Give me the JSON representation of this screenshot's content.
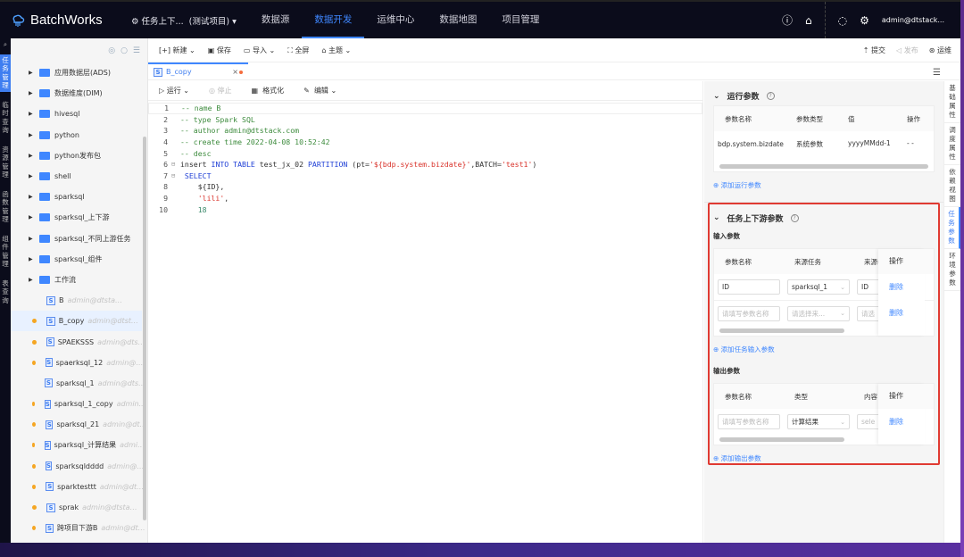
{
  "app": {
    "title": "BatchWorks",
    "project": "任务上下...",
    "project_env": "(测试项目)",
    "nav": [
      "数据源",
      "数据开发",
      "运维中心",
      "数据地图",
      "项目管理"
    ],
    "active_nav": "数据开发",
    "user": "admin@dtstack..."
  },
  "rail": [
    "任务管理",
    "临时查询",
    "资源管理",
    "函数管理",
    "组件管理",
    "表查询"
  ],
  "tree": {
    "folders": [
      "应用数据层(ADS)",
      "数据维度(DIM)",
      "hivesql",
      "python",
      "python发布包",
      "shell",
      "sparksql",
      "sparksql_上下游",
      "sparksql_不同上游任务",
      "sparksql_组件",
      "工作流"
    ],
    "files": [
      {
        "name": "B",
        "owner": "admin@dtstack.com 锁...",
        "dot": false
      },
      {
        "name": "B_copy",
        "owner": "admin@dtstack...",
        "dot": true
      },
      {
        "name": "SPAEKSSS",
        "owner": "admin@dtsta...",
        "dot": true
      },
      {
        "name": "spaerksql_12",
        "owner": "admin@dt...",
        "dot": true
      },
      {
        "name": "sparksql_1",
        "owner": "admin@dtsta...",
        "dot": false
      },
      {
        "name": "sparksql_1_copy",
        "owner": "admin...",
        "dot": true
      },
      {
        "name": "sparksql_21",
        "owner": "admin@dtst...",
        "dot": true
      },
      {
        "name": "sparksql_计算结果",
        "owner": "admin...",
        "dot": true
      },
      {
        "name": "sparksqldddd",
        "owner": "admin@dt...",
        "dot": true
      },
      {
        "name": "sparktesttt",
        "owner": "admin@dtsta...",
        "dot": true
      },
      {
        "name": "sprak",
        "owner": "admin@dtstack.co...",
        "dot": true
      },
      {
        "name": "跨项目下游B",
        "owner": "admin@dtst...",
        "dot": true
      }
    ]
  },
  "toolbar": {
    "new": "新建",
    "save": "保存",
    "import": "导入",
    "fullscreen": "全屏",
    "theme": "主题",
    "submit": "提交",
    "publish": "发布",
    "ops": "运维"
  },
  "tab": {
    "label": "B_copy",
    "icon_letter": "S"
  },
  "editor_toolbar": {
    "run": "运行",
    "stop": "停止",
    "format": "格式化",
    "edit": "编辑"
  },
  "code": [
    [
      [
        "cm",
        "-- name B"
      ]
    ],
    [
      [
        "cm",
        "-- type Spark SQL"
      ]
    ],
    [
      [
        "cm",
        "-- author admin@dtstack.com"
      ]
    ],
    [
      [
        "cm",
        "-- create time 2022-04-08 10:52:42"
      ]
    ],
    [
      [
        "cm",
        "-- desc"
      ]
    ],
    [
      [
        "",
        "insert "
      ],
      [
        "kw",
        "INTO TABLE"
      ],
      [
        "",
        " test_jx_02 "
      ],
      [
        "kw",
        "PARTITION"
      ],
      [
        "",
        " (pt="
      ],
      [
        "st",
        "'${bdp.system.bizdate}'"
      ],
      [
        "",
        ",BATCH="
      ],
      [
        "st",
        "'test1'"
      ],
      [
        "",
        ")"
      ]
    ],
    [
      [
        "kw",
        " SELECT"
      ]
    ],
    [
      [
        "",
        "    ${ID},"
      ]
    ],
    [
      [
        "st",
        "    'lili'"
      ],
      [
        "",
        ","
      ]
    ],
    [
      [
        "nm",
        "    18"
      ]
    ]
  ],
  "run_params": {
    "title": "运行参数",
    "headers": [
      "参数名称",
      "参数类型",
      "值",
      "操作"
    ],
    "rows": [
      [
        "bdp.system.bizdate",
        "系统参数",
        "yyyyMMdd-1",
        "- -"
      ]
    ],
    "add": "添加运行参数"
  },
  "task_params": {
    "title": "任务上下游参数",
    "input": {
      "label": "输入参数",
      "headers": [
        "参数名称",
        "来源任务",
        "来源参",
        "操作"
      ],
      "rows": [
        {
          "name": "ID",
          "source": "sparksql_1",
          "param": "ID",
          "op": "删除"
        },
        {
          "name_ph": "请填写参数名称",
          "source_ph": "请选择来...",
          "param_ph": "请选",
          "op": "删除"
        }
      ],
      "add": "添加任务输入参数"
    },
    "output": {
      "label": "输出参数",
      "headers": [
        "参数名称",
        "类型",
        "内容",
        "操作"
      ],
      "rows": [
        {
          "name_ph": "请填写参数名称",
          "type": "计算结果",
          "content_ph": "sele",
          "op": "删除"
        }
      ],
      "add": "添加输出参数"
    }
  },
  "vtabs": [
    "基础属性",
    "调度属性",
    "依赖视图",
    "任务参数",
    "环境参数"
  ],
  "active_vtab": "任务参数",
  "colors": {
    "accent": "#3f87ff",
    "topbar": "#0b0c1b",
    "highlight": "#e03a32",
    "modified_dot": "#f5a623"
  }
}
